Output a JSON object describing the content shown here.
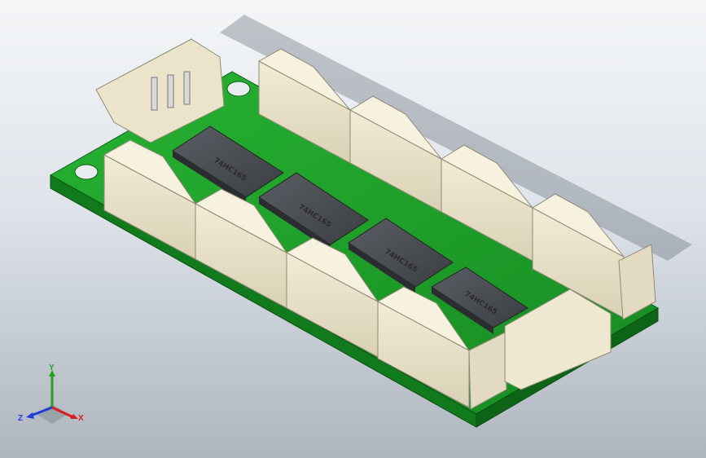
{
  "viewport": {
    "background_top": "#f4f6f8",
    "background_bottom": "#aeb5be"
  },
  "model": {
    "board_color": "#1f9a2a",
    "connector_color": "#ece6cf",
    "chip_color": "#4a4d52",
    "chips": [
      {
        "label": "74HC165"
      },
      {
        "label": "74HC165"
      },
      {
        "label": "74HC165"
      },
      {
        "label": "74HC165"
      }
    ]
  },
  "triad": {
    "x_label": "X",
    "y_label": "Y",
    "z_label": "Z",
    "x_color": "#d61e1e",
    "y_color": "#1ea31e",
    "z_color": "#1e3fd6"
  }
}
